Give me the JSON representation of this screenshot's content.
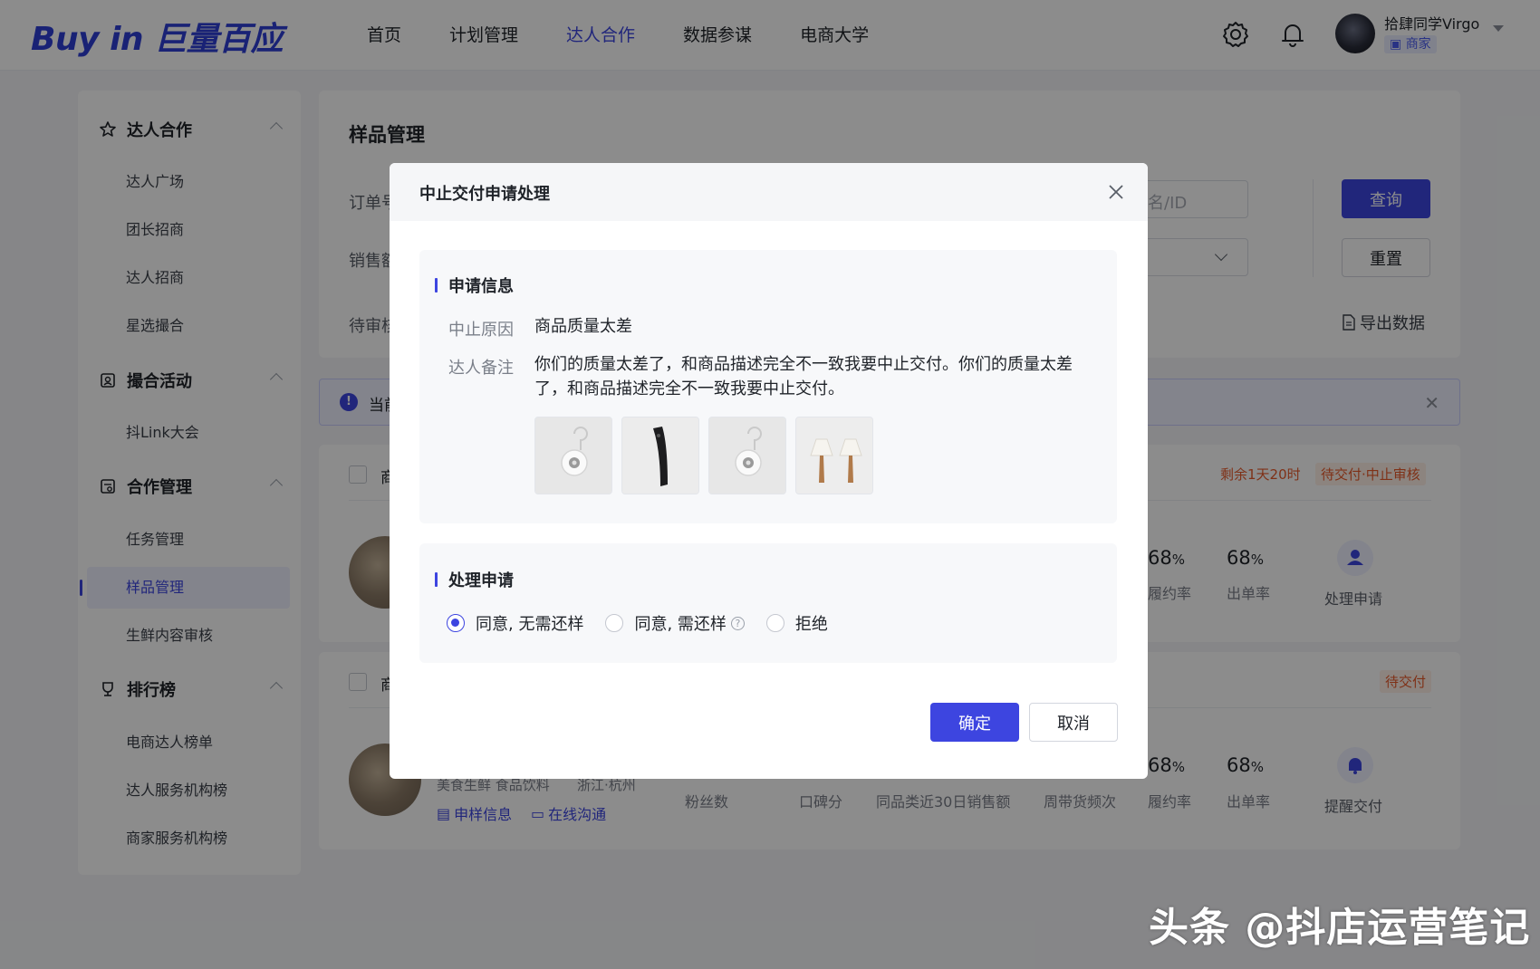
{
  "header": {
    "logo": "Buy in 巨量百应",
    "nav": [
      "首页",
      "计划管理",
      "达人合作",
      "数据参谋",
      "电商大学"
    ],
    "active_nav": "达人合作",
    "user_name": "拾肆同学Virgo",
    "user_role": "商家",
    "icons": [
      "gear-icon",
      "bell-icon"
    ]
  },
  "sidebar": {
    "groups": [
      {
        "title": "达人合作",
        "icon": "star-icon",
        "items": [
          "达人广场",
          "团长招商",
          "达人招商",
          "星选撮合"
        ]
      },
      {
        "title": "撮合活动",
        "icon": "activity-icon",
        "items": [
          "抖Link大会"
        ]
      },
      {
        "title": "合作管理",
        "icon": "manage-icon",
        "items": [
          "任务管理",
          "样品管理",
          "生鲜内容审核"
        ]
      },
      {
        "title": "排行榜",
        "icon": "trophy-icon",
        "items": [
          "电商达人榜单",
          "达人服务机构榜",
          "商家服务机构榜"
        ]
      }
    ],
    "active_item": "样品管理"
  },
  "page": {
    "title": "样品管理",
    "label_order": "订单号",
    "label_sales": "销售额",
    "label_pending": "待审核",
    "search_placeholder": "名/ID",
    "query_button": "查询",
    "reset_button": "重置",
    "export_link": "导出数据",
    "notice_text": "当前",
    "card1": {
      "product_prefix": "商",
      "countdown": "剩余1天20时",
      "status": "待交付·中止审核",
      "fulfill_rate": "68",
      "order_rate": "68",
      "percent": "%",
      "fulfill_label": "履约率",
      "order_label": "出单率",
      "action": "处理申请"
    },
    "card2": {
      "product_prefix": "商",
      "status": "待交付",
      "tags": "美食生鲜 食品饮料",
      "location": "浙江·杭州",
      "link_sample": "申样信息",
      "link_chat": "在线沟通",
      "col_fans": "粉丝数",
      "col_reputation": "口碑分",
      "col_sales": "同品类近30日销售额",
      "col_frequency": "周带货频次",
      "fulfill_rate": "68",
      "order_rate": "68",
      "percent": "%",
      "fulfill_label": "履约率",
      "order_label": "出单率",
      "action": "提醒交付"
    }
  },
  "modal": {
    "title": "中止交付申请处理",
    "section_info": "申请信息",
    "reason_label": "中止原因",
    "reason_value": "商品质量太差",
    "note_label": "达人备注",
    "note_value": "你们的质量太差了，和商品描述完全不一致我要中止交付。你们的质量太差了，和商品描述完全不一致我要中止交付。",
    "section_process": "处理申请",
    "options": [
      "同意, 无需还样",
      "同意, 需还样",
      "拒绝"
    ],
    "selected_option": "同意, 无需还样",
    "confirm_button": "确定",
    "cancel_button": "取消",
    "thumbnails": [
      "hook-product-photo",
      "black-device-photo",
      "hook-product-photo",
      "table-lamps-photo"
    ]
  },
  "watermark": "头条 @抖店运营笔记",
  "colors": {
    "primary": "#3d45e0",
    "warning": "#e85a2a"
  }
}
